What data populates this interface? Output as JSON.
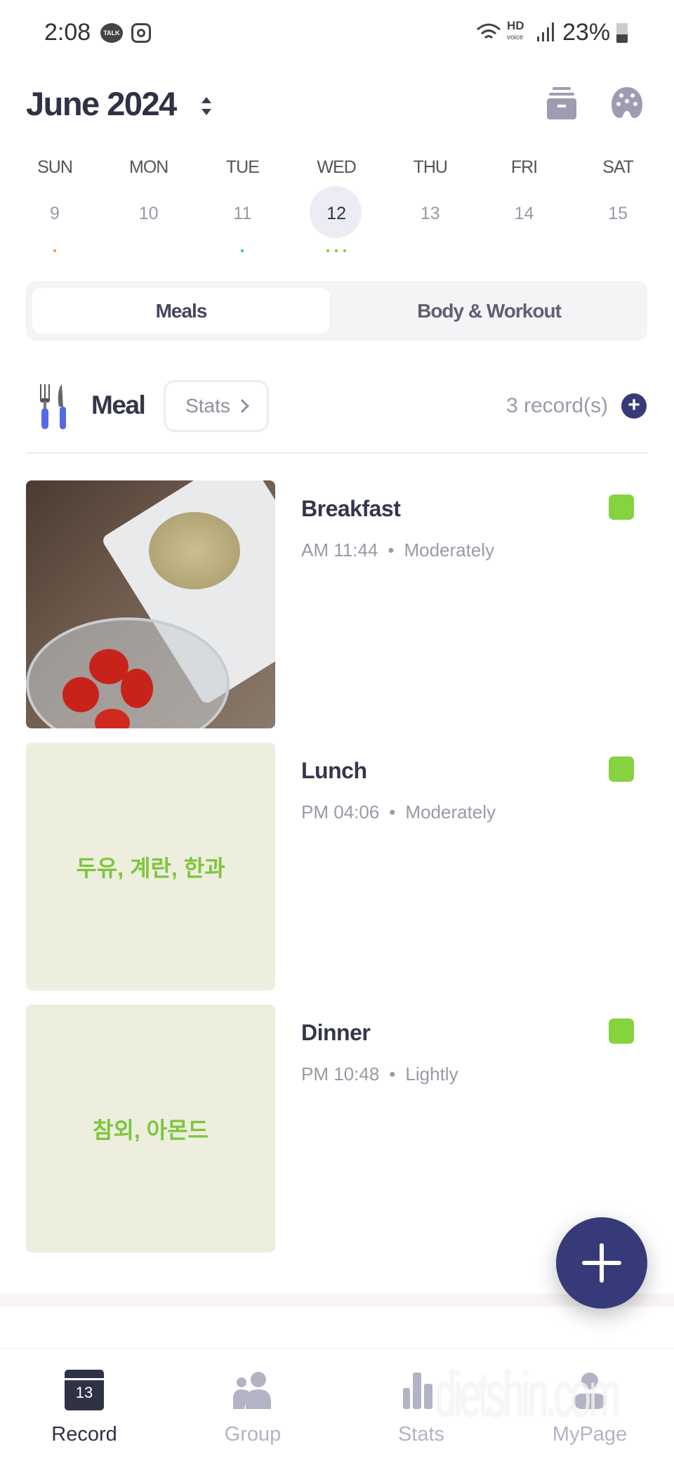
{
  "status_bar": {
    "time": "2:08",
    "notif_icons": [
      "kakaotalk-icon",
      "instagram-icon"
    ],
    "right_icons": [
      "wifi-icon",
      "hd-voice-icon",
      "signal-icon"
    ],
    "hd_label": "HD",
    "voice_label": "voice",
    "battery": "23%"
  },
  "header": {
    "month": "June 2024",
    "icons": [
      "archive-icon",
      "palette-icon"
    ]
  },
  "week": {
    "days": [
      {
        "label": "SUN",
        "date": "9",
        "dots": [
          "#f0a040"
        ]
      },
      {
        "label": "MON",
        "date": "10",
        "dots": []
      },
      {
        "label": "TUE",
        "date": "11",
        "dots": [
          "#3cc7b8"
        ]
      },
      {
        "label": "WED",
        "date": "12",
        "dots": [
          "#86d33f",
          "#86d33f",
          "#86d33f"
        ],
        "selected": true
      },
      {
        "label": "THU",
        "date": "13",
        "dots": []
      },
      {
        "label": "FRI",
        "date": "14",
        "dots": []
      },
      {
        "label": "SAT",
        "date": "15",
        "dots": []
      }
    ]
  },
  "tabs": [
    {
      "label": "Meals",
      "active": true
    },
    {
      "label": "Body & Workout",
      "active": false
    }
  ],
  "meal_section": {
    "title": "Meal",
    "stats_label": "Stats",
    "count": "3 record(s)"
  },
  "records": [
    {
      "title": "Breakfast",
      "time": "AM 11:44",
      "amount": "Moderately",
      "image": "photo",
      "status_color": "#86d33f"
    },
    {
      "title": "Lunch",
      "time": "PM 04:06",
      "amount": "Moderately",
      "image_text": "두유, 계란, 한과",
      "status_color": "#86d33f"
    },
    {
      "title": "Dinner",
      "time": "PM 10:48",
      "amount": "Lightly",
      "image_text": "참외, 아몬드",
      "status_color": "#86d33f"
    }
  ],
  "nav": [
    {
      "label": "Record",
      "badge": "13",
      "active": true
    },
    {
      "label": "Group"
    },
    {
      "label": "Stats"
    },
    {
      "label": "MyPage"
    }
  ],
  "watermark": "dietshin.com",
  "colors": {
    "accent": "#363a78",
    "active_text": "#2f3145",
    "inactive": "#b3b3c6"
  }
}
